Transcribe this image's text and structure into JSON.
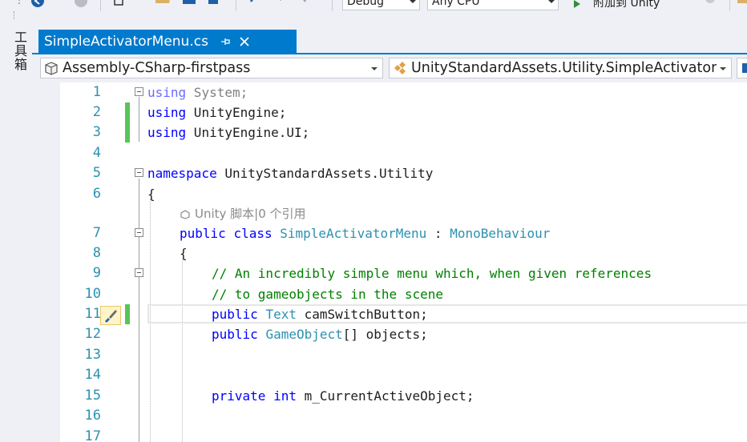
{
  "toolbar": {
    "configuration": "Debug",
    "platform": "Any CPU",
    "attach_label": "附加到 Unity"
  },
  "left_strip": {
    "toolbox_label": "工具箱"
  },
  "document_tab": {
    "title": "SimpleActivatorMenu.cs"
  },
  "nav": {
    "project": "Assembly-CSharp-firstpass",
    "type": "UnityStandardAssets.Utility.SimpleActivator"
  },
  "editor": {
    "line_numbers": [
      "1",
      "2",
      "3",
      "4",
      "5",
      "6",
      "7",
      "8",
      "9",
      "10",
      "11",
      "12",
      "13",
      "14",
      "15",
      "16",
      "17"
    ],
    "lines": {
      "l1_kw": "using",
      "l1_rest": " System;",
      "l2_kw": "using",
      "l2_rest": " UnityEngine;",
      "l3_kw": "using",
      "l3_rest": " UnityEngine.UI;",
      "l5_kw": "namespace",
      "l5_rest": " UnityStandardAssets.Utility",
      "l6": "{",
      "codelens": "Unity 脚本|0 个引用",
      "l7_kw1": "public",
      "l7_kw2": "class",
      "l7_name": "SimpleActivatorMenu",
      "l7_colon": " : ",
      "l7_base": "MonoBehaviour",
      "l8": "{",
      "l9": "// An incredibly simple menu which, when given references",
      "l10": "// to gameobjects in the scene",
      "l11_kw": "public",
      "l11_type": "Text",
      "l11_rest": " camSwitchButton;",
      "l12_kw": "public",
      "l12_type": "GameObject",
      "l12_rest": "[] objects;",
      "l15_kw1": "private",
      "l15_kw2": "int",
      "l15_rest": " m_CurrentActiveObject;"
    }
  },
  "colors": {
    "accent": "#007acc",
    "keyword": "#0000ff",
    "type": "#2b91af",
    "comment": "#008000",
    "change_bar": "#57c457"
  }
}
